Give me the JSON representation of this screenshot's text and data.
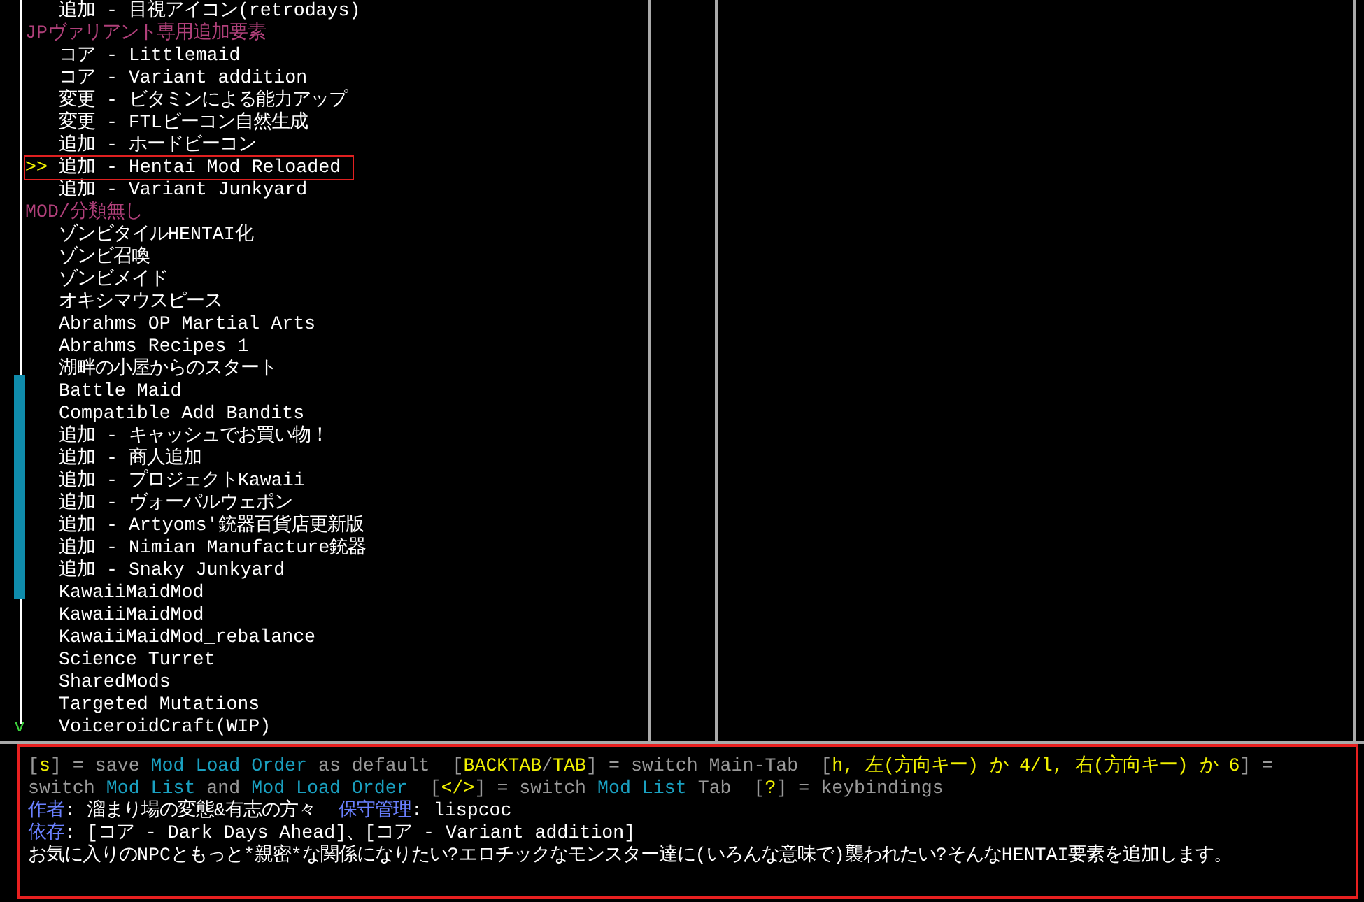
{
  "cursor_marker": ">>",
  "more_below_marker": "v",
  "mod_list": [
    {
      "kind": "mod",
      "label": "追加 - 目視アイコン(retrodays)",
      "selected": false
    },
    {
      "kind": "category",
      "label": "JPヴァリアント専用追加要素",
      "selected": false
    },
    {
      "kind": "mod",
      "label": "コア - Littlemaid",
      "selected": false
    },
    {
      "kind": "mod",
      "label": "コア - Variant addition",
      "selected": false
    },
    {
      "kind": "mod",
      "label": "変更 - ビタミンによる能力アップ",
      "selected": false
    },
    {
      "kind": "mod",
      "label": "変更 - FTLビーコン自然生成",
      "selected": false
    },
    {
      "kind": "mod",
      "label": "追加 - ホードビーコン",
      "selected": false
    },
    {
      "kind": "mod",
      "label": "追加 - Hentai Mod Reloaded",
      "selected": true
    },
    {
      "kind": "mod",
      "label": "追加 - Variant Junkyard",
      "selected": false
    },
    {
      "kind": "category",
      "label": "MOD/分類無し",
      "selected": false
    },
    {
      "kind": "mod",
      "label": "ゾンビタイルHENTAI化",
      "selected": false
    },
    {
      "kind": "mod",
      "label": "ゾンビ召喚",
      "selected": false
    },
    {
      "kind": "mod",
      "label": "ゾンビメイド",
      "selected": false
    },
    {
      "kind": "mod",
      "label": "オキシマウスピース",
      "selected": false
    },
    {
      "kind": "mod",
      "label": "Abrahms OP Martial Arts",
      "selected": false
    },
    {
      "kind": "mod",
      "label": "Abrahms Recipes 1",
      "selected": false
    },
    {
      "kind": "mod",
      "label": "湖畔の小屋からのスタート",
      "selected": false
    },
    {
      "kind": "mod",
      "label": "Battle Maid",
      "selected": false
    },
    {
      "kind": "mod",
      "label": "Compatible Add Bandits",
      "selected": false
    },
    {
      "kind": "mod",
      "label": "追加 - キャッシュでお買い物！",
      "selected": false
    },
    {
      "kind": "mod",
      "label": "追加 - 商人追加",
      "selected": false
    },
    {
      "kind": "mod",
      "label": "追加 - プロジェクトKawaii",
      "selected": false
    },
    {
      "kind": "mod",
      "label": "追加 - ヴォーパルウェポン",
      "selected": false
    },
    {
      "kind": "mod",
      "label": "追加 - Artyoms'銃器百貨店更新版",
      "selected": false
    },
    {
      "kind": "mod",
      "label": "追加 - Nimian Manufacture銃器",
      "selected": false
    },
    {
      "kind": "mod",
      "label": "追加 - Snaky Junkyard",
      "selected": false
    },
    {
      "kind": "mod",
      "label": "KawaiiMaidMod",
      "selected": false
    },
    {
      "kind": "mod",
      "label": "KawaiiMaidMod",
      "selected": false
    },
    {
      "kind": "mod",
      "label": "KawaiiMaidMod_rebalance",
      "selected": false
    },
    {
      "kind": "mod",
      "label": "Science Turret",
      "selected": false
    },
    {
      "kind": "mod",
      "label": "SharedMods",
      "selected": false
    },
    {
      "kind": "mod",
      "label": "Targeted Mutations",
      "selected": false
    },
    {
      "kind": "mod",
      "label": "VoiceroidCraft(WIP)",
      "selected": false
    }
  ],
  "keybindings_help": [
    {
      "kind": "plain",
      "text": "["
    },
    {
      "kind": "key",
      "text": "s"
    },
    {
      "kind": "plain",
      "text": "] = save "
    },
    {
      "kind": "term",
      "text": "Mod Load Order"
    },
    {
      "kind": "plain",
      "text": " as default  ["
    },
    {
      "kind": "key",
      "text": "BACKTAB"
    },
    {
      "kind": "plain",
      "text": "/"
    },
    {
      "kind": "key",
      "text": "TAB"
    },
    {
      "kind": "plain",
      "text": "] = switch Main-Tab  ["
    },
    {
      "kind": "key",
      "text": "h, 左(方向キー) か 4/l, 右(方向キー) か 6"
    },
    {
      "kind": "plain",
      "text": "] = switch "
    },
    {
      "kind": "term",
      "text": "Mod List"
    },
    {
      "kind": "plain",
      "text": " and "
    },
    {
      "kind": "term",
      "text": "Mod Load Order"
    },
    {
      "kind": "plain",
      "text": "  ["
    },
    {
      "kind": "key",
      "text": "</>"
    },
    {
      "kind": "plain",
      "text": "] = switch "
    },
    {
      "kind": "term",
      "text": "Mod List"
    },
    {
      "kind": "plain",
      "text": " Tab  ["
    },
    {
      "kind": "key",
      "text": "?"
    },
    {
      "kind": "plain",
      "text": "] = keybindings"
    }
  ],
  "details": {
    "author_label": "作者",
    "author": ": 溜まり場の変態&有志の方々",
    "maintainer_label": "保守管理",
    "maintainer": ": lispcoc",
    "dependencies_label": "依存",
    "dependencies": ": [コア - Dark Days Ahead]、[コア - Variant addition]",
    "description": "お気に入りのNPCともっと*親密*な関係になりたい?エロチックなモンスター達に(いろんな意味で)襲われたい?そんなHENTAI要素を追加します。"
  }
}
